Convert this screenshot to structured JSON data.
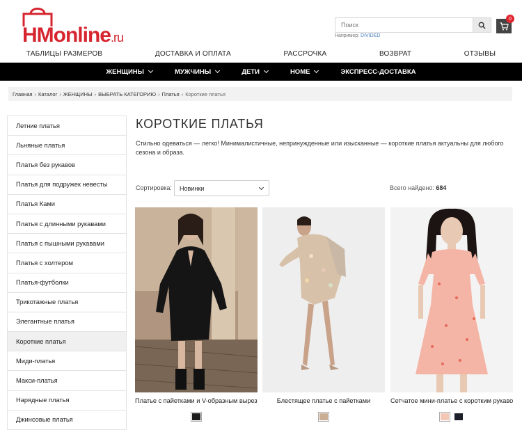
{
  "brand": {
    "logo_text_main": "HMonline",
    "logo_text_suffix": ".ru",
    "logo_color": "#d6252f"
  },
  "search": {
    "placeholder": "Поиск",
    "hint_prefix": "Например:",
    "hint_example": "DIVIDED"
  },
  "cart": {
    "count": "0"
  },
  "top_nav": [
    "ТАБЛИЦЫ РАЗМЕРОВ",
    "ДОСТАВКА И ОПЛАТА",
    "РАССРОЧКА",
    "ВОЗВРАТ",
    "ОТЗЫВЫ"
  ],
  "main_nav": [
    {
      "label": "ЖЕНЩИНЫ",
      "has_dropdown": true
    },
    {
      "label": "МУЖЧИНЫ",
      "has_dropdown": true
    },
    {
      "label": "ДЕТИ",
      "has_dropdown": true
    },
    {
      "label": "HOME",
      "has_dropdown": true
    },
    {
      "label": "ЭКСПРЕСС-ДОСТАВКА",
      "has_dropdown": false
    }
  ],
  "breadcrumb": [
    "Главная",
    "Каталог",
    "ЖЕНЩИНЫ",
    "ВЫБРАТЬ КАТЕГОРИЮ",
    "Платья",
    "Короткие платья"
  ],
  "sidebar": {
    "items": [
      "Летние платья",
      "Льняные платья",
      "Платья без рукавов",
      "Платья для подружек невесты",
      "Платья Ками",
      "Платья с длинными рукавами",
      "Платья с пышными рукавами",
      "Платья с холтером",
      "Платья-футболки",
      "Трикотажные платья",
      "Элегантные платья",
      "Короткие платья",
      "Миди-платья",
      "Макси-платья",
      "Нарядные платья",
      "Джинсовые платья"
    ],
    "active_index": 11
  },
  "page": {
    "title": "КОРОТКИЕ ПЛАТЬЯ",
    "description": "Стильно одеваться — легко! Минималистичные, непринужденные или изысканные — короткие платья актуальны для любого сезона и образа."
  },
  "sort": {
    "label": "Сортировка:",
    "selected": "Новинки"
  },
  "results": {
    "label": "Всего найдено:",
    "count": "684"
  },
  "products": [
    {
      "name": "Платье с пайетками и V-образным вырезом",
      "swatches": [
        "#1b1b1b"
      ],
      "selected": 0
    },
    {
      "name": "Блестящее платье с пайетками",
      "swatches": [
        "#c9ad95"
      ],
      "selected": 0
    },
    {
      "name": "Сетчатое мини-платье с коротким рукавом",
      "swatches": [
        "#f3c6b5",
        "#1d1f2a"
      ],
      "selected": 0
    }
  ]
}
